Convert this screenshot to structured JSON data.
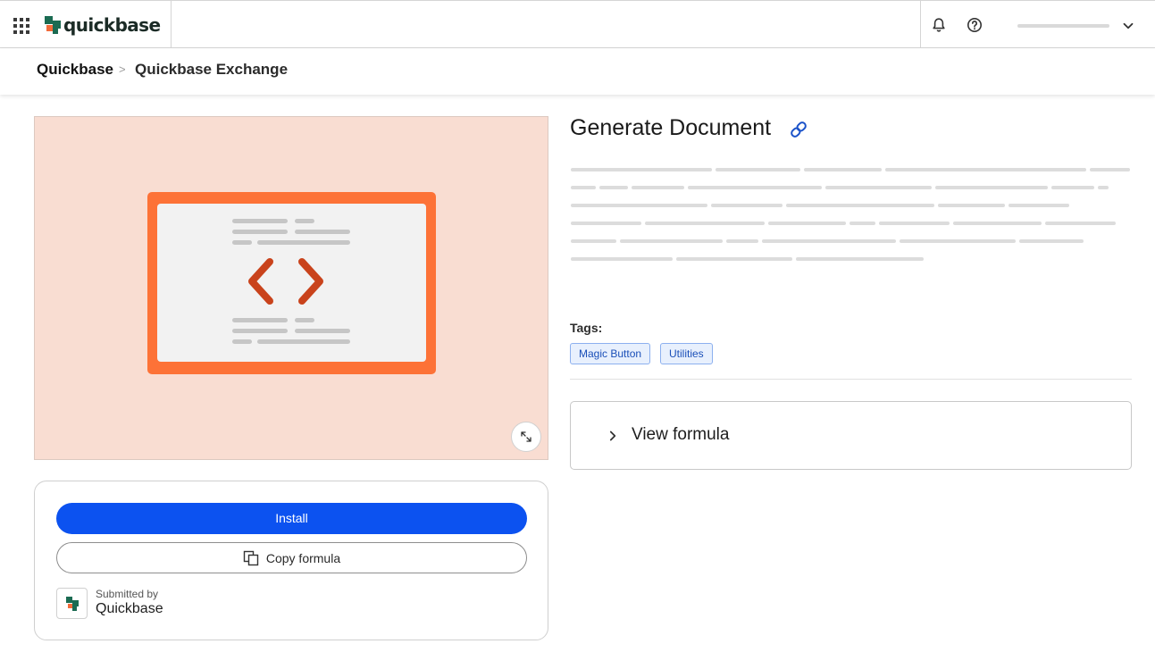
{
  "app": {
    "brand": "quickbase",
    "icons": {
      "apps": "app-grid-icon",
      "bell": "bell-icon",
      "help": "help-circle-icon",
      "user_menu": "chevron-down-icon"
    }
  },
  "breadcrumb": {
    "items": [
      "Quickbase",
      "Quickbase Exchange"
    ],
    "separator": ">"
  },
  "item": {
    "title": "Generate Document",
    "tags_label": "Tags:",
    "tags": [
      "Magic Button",
      "Utilities"
    ],
    "view_formula_label": "View formula"
  },
  "actions": {
    "install_label": "Install",
    "copy_label": "Copy formula"
  },
  "submitter": {
    "label": "Submitted by",
    "name": "Quickbase"
  },
  "colors": {
    "accent": "#0c52f0",
    "preview_bg": "#f9ddd2",
    "preview_frame": "#fd7237",
    "code_bracket": "#c9431c",
    "tag_bg": "#e8f0fd",
    "tag_border": "#8cb0ef",
    "brand_green": "#1b6b52",
    "brand_orange": "#f26b3a"
  }
}
